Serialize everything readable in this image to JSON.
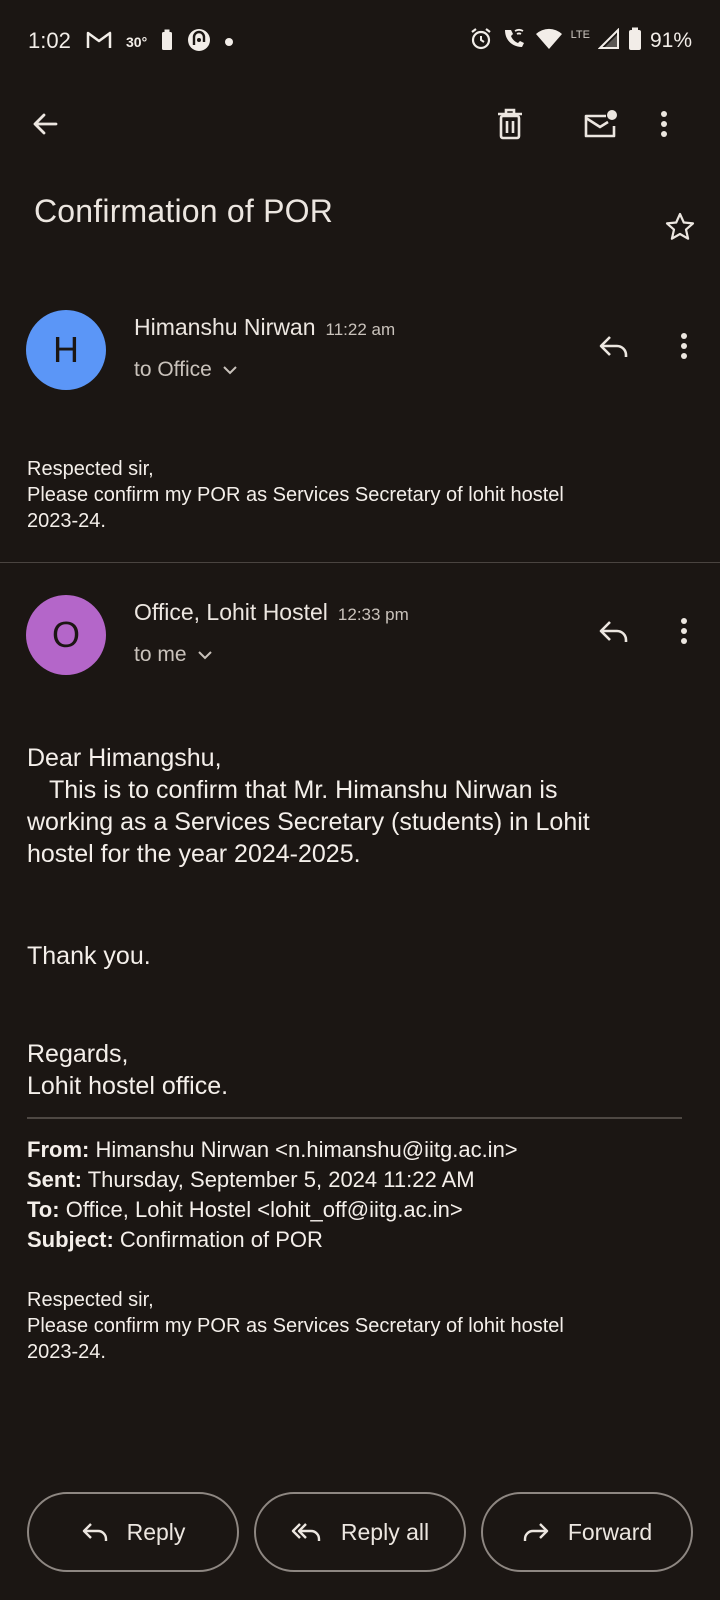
{
  "status_bar": {
    "time": "1:02",
    "temperature": "30°",
    "battery": "91%",
    "network": "LTE"
  },
  "toolbar": {
    "back_icon": "arrow-left-icon",
    "delete_icon": "trash-icon",
    "mark_unread_icon": "mail-unread-icon",
    "more_icon": "more-vert-icon"
  },
  "subject": "Confirmation of POR",
  "messages": [
    {
      "avatar_letter": "H",
      "avatar_color": "#5b96f7",
      "sender": "Himanshu Nirwan",
      "time": "11:22 am",
      "recipient": "to Office",
      "body": [
        "Respected sir,",
        "Please confirm my POR as Services Secretary of lohit hostel",
        "2023-24."
      ]
    },
    {
      "avatar_letter": "O",
      "avatar_color": "#b466c9",
      "sender": "Office, Lohit Hostel",
      "time": "12:33 pm",
      "recipient": "to me",
      "body": [
        "Dear Himangshu,",
        "This is to confirm that Mr. Himanshu Nirwan is",
        "working as a Services Secretary (students) in Lohit",
        "hostel for the year 2024-2025.",
        "Thank you.",
        "Regards,",
        "Lohit hostel office."
      ],
      "quoted": {
        "from_label": "From:",
        "from_value": "Himanshu Nirwan <n.himanshu@iitg.ac.in>",
        "sent_label": "Sent:",
        "sent_value": "Thursday, September 5, 2024 11:22 AM",
        "to_label": "To:",
        "to_value": "Office, Lohit Hostel <lohit_off@iitg.ac.in>",
        "subject_label": "Subject:",
        "subject_value": "Confirmation of POR",
        "body": [
          "Respected sir,",
          "Please confirm my POR as Services Secretary of lohit hostel",
          "2023-24."
        ]
      }
    }
  ],
  "actions": {
    "reply": "Reply",
    "reply_all": "Reply all",
    "forward": "Forward"
  }
}
